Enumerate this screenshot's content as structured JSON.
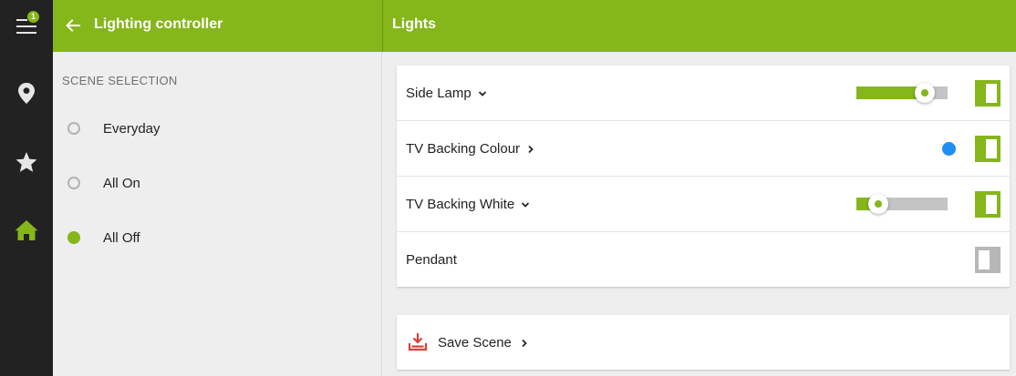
{
  "rail": {
    "menu_badge": "1",
    "items": [
      {
        "icon": "menu-icon"
      },
      {
        "icon": "location-pin-icon"
      },
      {
        "icon": "star-icon"
      },
      {
        "icon": "home-icon",
        "active": true
      }
    ]
  },
  "header": {
    "title": "Lighting controller",
    "right_title": "Lights"
  },
  "scenes": {
    "heading": "SCENE SELECTION",
    "items": [
      {
        "label": "Everyday",
        "selected": false
      },
      {
        "label": "All On",
        "selected": false
      },
      {
        "label": "All Off",
        "selected": true
      }
    ]
  },
  "lights": [
    {
      "name": "Side Lamp",
      "chevron": "down",
      "level": 0.75,
      "on": true
    },
    {
      "name": "TV Backing Colour",
      "chevron": "right",
      "color": "#1e8ff0",
      "on": true
    },
    {
      "name": "TV Backing White",
      "chevron": "down",
      "level": 0.24,
      "on": true
    },
    {
      "name": "Pendant",
      "on": false
    }
  ],
  "save": {
    "label": "Save Scene"
  },
  "colors": {
    "accent": "#85b61a",
    "rail_bg": "#222222",
    "save_icon": "#d8403a"
  }
}
